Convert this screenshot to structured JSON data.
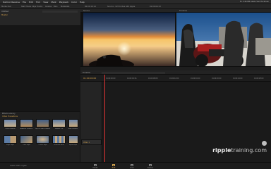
{
  "menubar": {
    "app": "DaVinci Resolve",
    "items": [
      "File",
      "Edit",
      "Trim",
      "View",
      "Mark",
      "Playback",
      "Color",
      "Help"
    ],
    "right": "Fri 3:46 PM  Alexis Van Hurkman"
  },
  "toolbar": {
    "left": "Media Pool",
    "items": [
      "Start Show Clips",
      "Tracks",
      "Grades",
      "Bins",
      "Metadata"
    ],
    "viewer_title": "Source - 02 Pro Res 444 Apple",
    "timecode_a": "00:00:19:14",
    "timecode_b": "01:00:04:13"
  },
  "media_pool": {
    "master_label": "Master",
    "search_hint": "Untitled",
    "tab_label": "Effects Library"
  },
  "viewer": {
    "left_label": "Source",
    "right_label": "Timeline"
  },
  "timeline": {
    "toolbar_label": "Timeline",
    "timecode": "01:00:00:00",
    "ruler_ticks": [
      "01:00:00:00",
      "01:00:04:16",
      "01:00:08:08",
      "01:00:12:00",
      "01:00:16:00",
      "01:00:20:00",
      "01:00:24:00",
      "01:00:28:00"
    ],
    "track_label": "Video 1"
  },
  "effects": {
    "header": "Effects Library",
    "section": "Video Transitions",
    "items": [
      [
        "Cross Dissolve",
        "Additive Dissolve",
        "Dip To Color Dissolve",
        "Smooth Cut",
        "Blur Dissolve"
      ],
      [
        "Edge Wipe",
        "Clock Wipe",
        "Center Wipe",
        "Venetian Blind",
        "Spiral Wipe"
      ]
    ]
  },
  "pagebar": {
    "pages": [
      "Media",
      "Edit",
      "Color",
      "Deliver"
    ],
    "active": "Edit",
    "status": "Assets 100% Ingest"
  },
  "watermark": {
    "brand": "ripple",
    "suffix": "training.com"
  },
  "colors": {
    "accent": "#d6a44c",
    "playhead": "#e03434"
  }
}
